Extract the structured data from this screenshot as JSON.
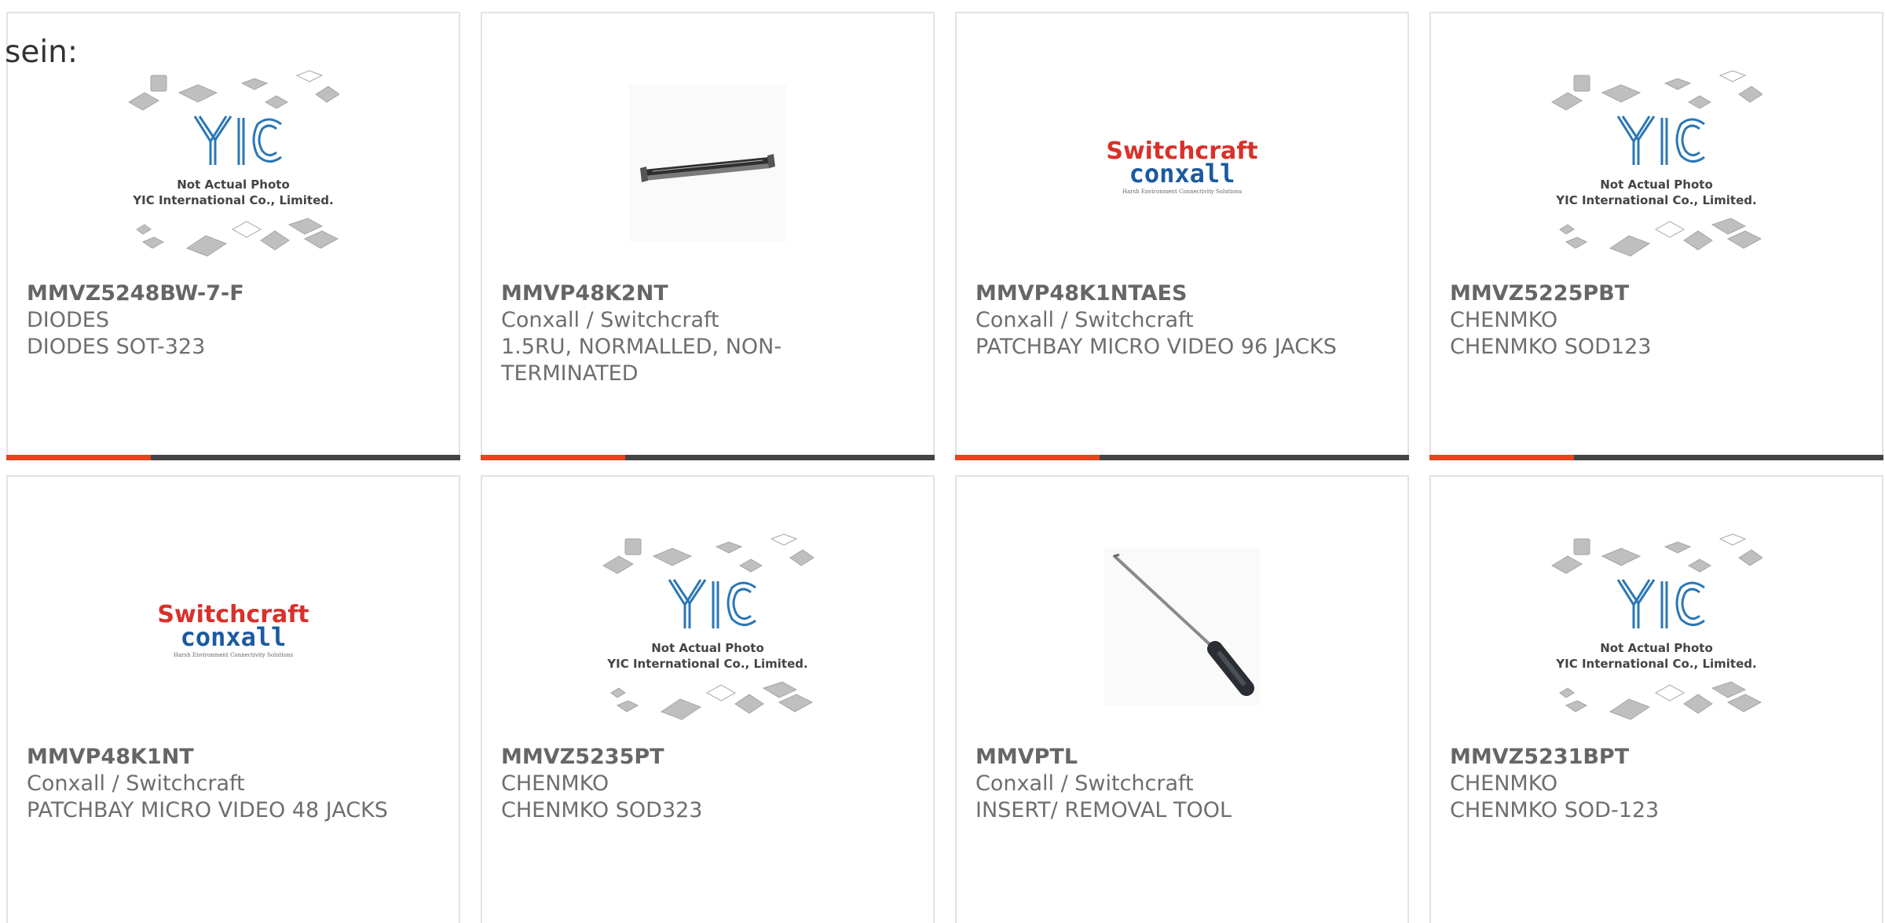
{
  "lead_text": "sein:",
  "accent_color": "#e8441d",
  "placeholder_image": {
    "line1": "Not Actual Photo",
    "line2": "YIC International Co., Limited.",
    "logo": "YIC"
  },
  "switchcraft_logo": {
    "top": "Switchcraft",
    "bottom": "conxall",
    "tagline": "Harsh Environment Connectivity Solutions"
  },
  "products": [
    {
      "pn": "MMVZ5248BW-7-F",
      "mfr": "DIODES",
      "desc": "DIODES SOT-323",
      "image": "yic-placeholder"
    },
    {
      "pn": "MMVP48K2NT",
      "mfr": "Conxall / Switchcraft",
      "desc": "1.5RU, NORMALLED, NON-TERMINATED",
      "image": "patchbay-photo"
    },
    {
      "pn": "MMVP48K1NTAES",
      "mfr": "Conxall / Switchcraft",
      "desc": "PATCHBAY MICRO VIDEO 96 JACKS",
      "image": "switchcraft-logo"
    },
    {
      "pn": "MMVZ5225PBT",
      "mfr": "CHENMKO",
      "desc": "CHENMKO SOD123",
      "image": "yic-placeholder"
    },
    {
      "pn": "MMVP48K1NT",
      "mfr": "Conxall / Switchcraft",
      "desc": "PATCHBAY MICRO VIDEO 48 JACKS",
      "image": "switchcraft-logo"
    },
    {
      "pn": "MMVZ5235PT",
      "mfr": "CHENMKO",
      "desc": "CHENMKO SOD323",
      "image": "yic-placeholder"
    },
    {
      "pn": "MMVPTL",
      "mfr": "Conxall / Switchcraft",
      "desc": "INSERT/ REMOVAL TOOL",
      "image": "tool-photo"
    },
    {
      "pn": "MMVZ5231BPT",
      "mfr": "CHENMKO",
      "desc": "CHENMKO SOD-123",
      "image": "yic-placeholder"
    }
  ]
}
